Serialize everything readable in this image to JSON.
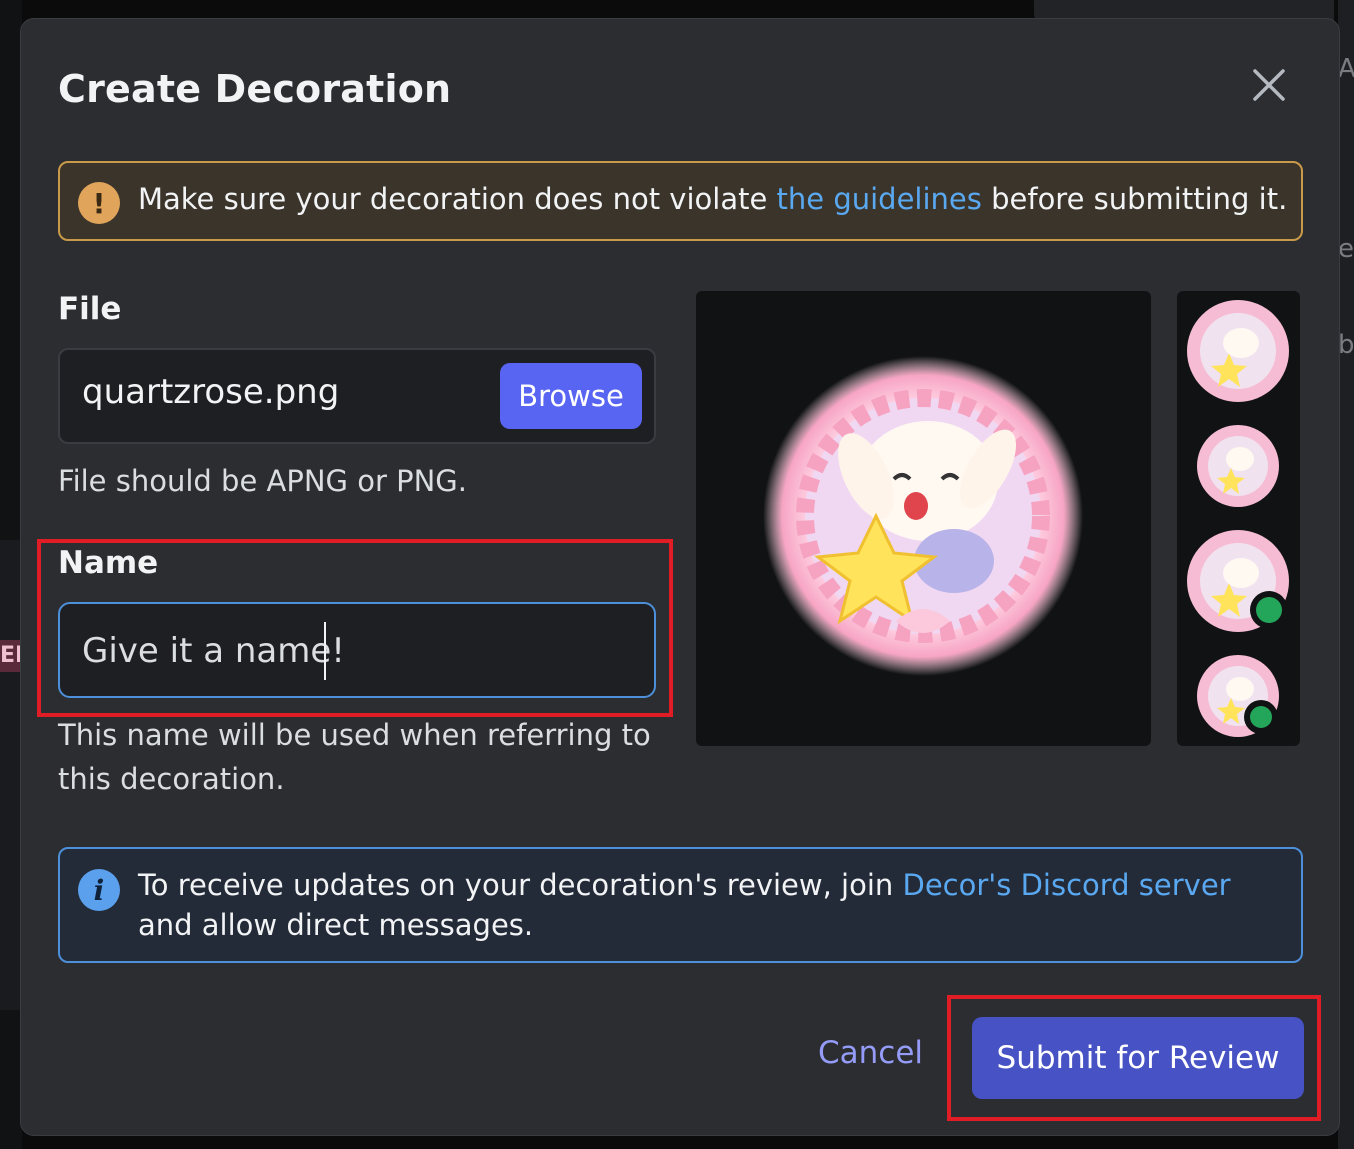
{
  "modal": {
    "title": "Create Decoration",
    "warning": {
      "text_before": "Make sure your decoration does not violate ",
      "link": "the guidelines",
      "text_after": " before submitting it."
    },
    "file": {
      "label": "File",
      "filename": "quartzrose.png",
      "browse_label": "Browse",
      "hint": "File should be APNG or PNG."
    },
    "name": {
      "label": "Name",
      "placeholder": "Give it a name!",
      "value": "",
      "hint": "This name will be used when referring to this decoration."
    },
    "info": {
      "text_before": "To receive updates on your decoration's review, join ",
      "link": "Decor's Discord server",
      "text_after": " and allow direct messages."
    },
    "footer": {
      "cancel_label": "Cancel",
      "submit_label": "Submit for Review"
    }
  },
  "colors": {
    "accent": "#5865f2",
    "submit": "#4752c4",
    "warning_border": "#c99a4a",
    "info_border": "#4d8fd8",
    "link": "#5aa8f0",
    "online_status": "#23a55a",
    "highlight": "#e01c24"
  },
  "preview": {
    "decoration_image": "pink-crystal-wreath-bunny-with-star",
    "sizes": [
      "large",
      "medium",
      "medium-online",
      "small-online"
    ]
  }
}
